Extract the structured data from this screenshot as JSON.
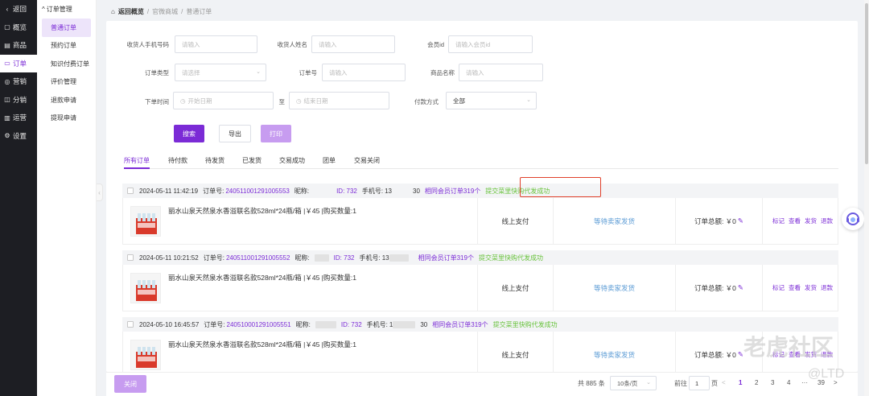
{
  "nav": {
    "back": "返回",
    "items": [
      {
        "label": "概览",
        "icon": "overview-icon"
      },
      {
        "label": "商品",
        "icon": "goods-icon"
      },
      {
        "label": "订单",
        "icon": "order-icon"
      },
      {
        "label": "营销",
        "icon": "marketing-icon"
      },
      {
        "label": "分销",
        "icon": "distribution-icon"
      },
      {
        "label": "运营",
        "icon": "chart-icon"
      },
      {
        "label": "设置",
        "icon": "gear-icon"
      }
    ]
  },
  "subnav": {
    "head": "订单管理",
    "items": [
      "普通订单",
      "预约订单",
      "知识付费订单",
      "评价管理",
      "退款申请",
      "提现申请"
    ]
  },
  "breadcrumb": {
    "home": "返回概览",
    "mid": "官微商城",
    "current": "普通订单",
    "sep": "/"
  },
  "filters": {
    "phone_label": "收货人手机号码",
    "phone_ph": "请输入",
    "name_label": "收货人姓名",
    "name_ph": "请输入",
    "member_label": "会员id",
    "member_ph": "请输入会员id",
    "type_label": "订单类型",
    "type_ph": "请选择",
    "orderno_label": "订单号",
    "orderno_ph": "请输入",
    "goods_label": "商品名称",
    "goods_ph": "请输入",
    "time_label": "下单时间",
    "start_ph": "开始日期",
    "to": "至",
    "end_ph": "结束日期",
    "pay_label": "付款方式",
    "pay_value": "全部"
  },
  "buttons": {
    "search": "搜索",
    "export": "导出",
    "print": "打印",
    "close": "关闭"
  },
  "tabs": [
    "所有订单",
    "待付款",
    "待发货",
    "已发货",
    "交易成功",
    "团单",
    "交易关闭"
  ],
  "orders": [
    {
      "time": "2024-05-11 11:42:19",
      "no_label": "订单号:",
      "no": "240511001291005553",
      "nick_label": "昵称:",
      "id_text": "ID: 732",
      "phone_label": "手机号:",
      "phone_a": "13",
      "phone_b": "30",
      "related": "相同会员订单319个",
      "status": "提交菜里快购代发成功",
      "title": "丽水山泉天然泉水香溢联名款528ml*24瓶/箱 |￥45 |购买数量:1",
      "pay": "线上支付",
      "ship": "等待卖家发货",
      "total": "订单总额: ￥0"
    },
    {
      "time": "2024-05-11 10:21:52",
      "no_label": "订单号:",
      "no": "240511001291005552",
      "nick_label": "昵称:",
      "id_text": "ID: 732",
      "phone_label": "手机号:",
      "phone_a": "13",
      "phone_b": "",
      "related": "相同会员订单319个",
      "status": "提交菜里快购代发成功",
      "title": "丽水山泉天然泉水香溢联名款528ml*24瓶/箱 |￥45 |购买数量:1",
      "pay": "线上支付",
      "ship": "等待卖家发货",
      "total": "订单总额: ￥0"
    },
    {
      "time": "2024-05-10 16:45:57",
      "no_label": "订单号:",
      "no": "240510001291005551",
      "nick_label": "昵称:",
      "id_text": "ID: 732",
      "phone_label": "手机号:",
      "phone_a": "1",
      "phone_b": "30",
      "related": "相同会员订单319个",
      "status": "提交菜里快购代发成功",
      "title": "丽水山泉天然泉水香溢联名款528ml*24瓶/箱 |￥45 |购买数量:1",
      "pay": "线上支付",
      "ship": "等待卖家发货",
      "total": "订单总额: ￥0"
    }
  ],
  "ops": [
    "标记",
    "查看",
    "发货",
    "退款"
  ],
  "pager": {
    "total": "共 885 条",
    "size": "10条/页",
    "goto": "前往",
    "page_input": "1",
    "page_unit": "页",
    "prev": "<",
    "pages": [
      "1",
      "2",
      "3",
      "4"
    ],
    "ellipsis": "···",
    "last": "39",
    "next": ">"
  },
  "watermark": {
    "text": "老虎社区",
    "sub": "@LTD"
  },
  "colors": {
    "accent": "#7b2bd6",
    "success": "#67c23a",
    "highlight": "#e0402a"
  }
}
